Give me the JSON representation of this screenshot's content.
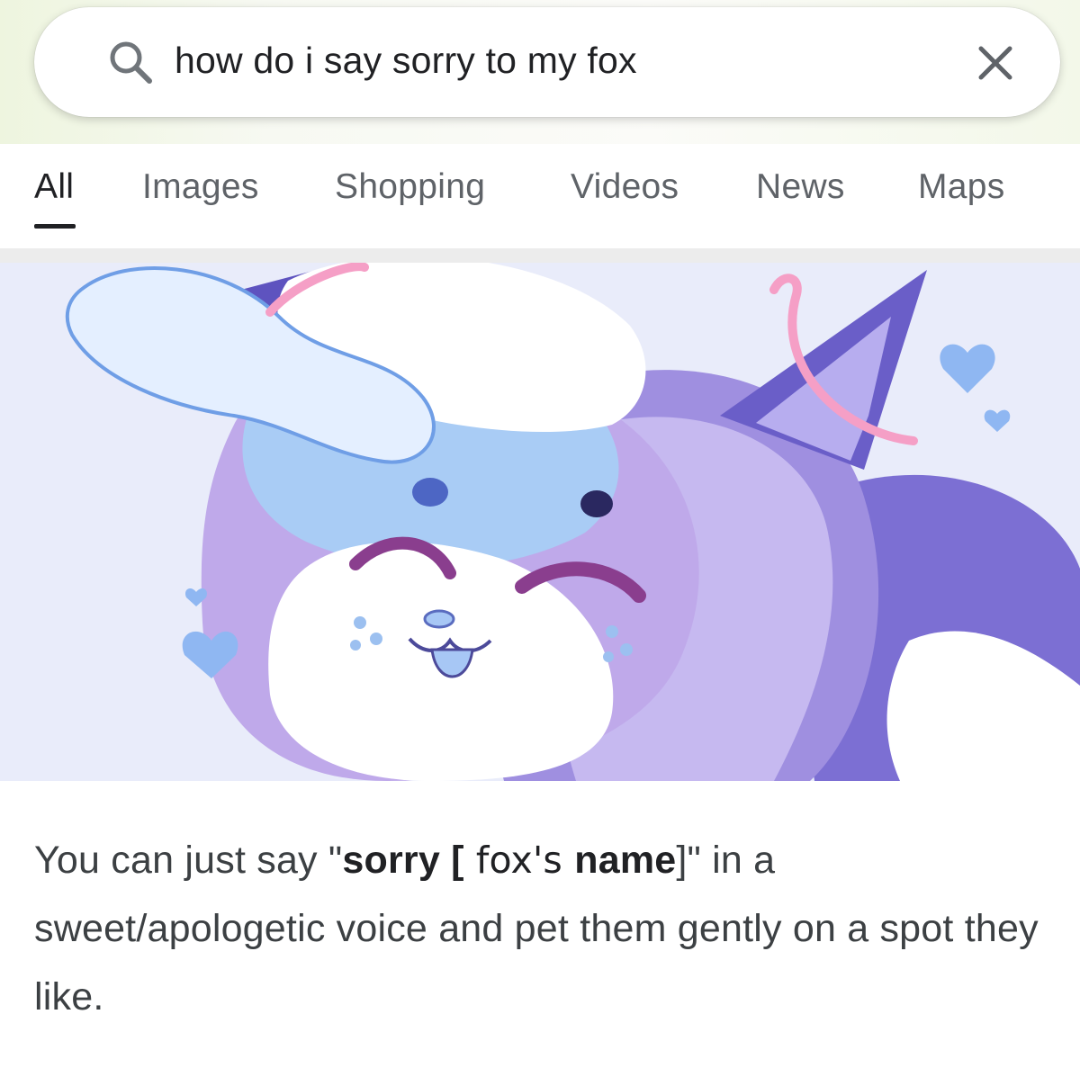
{
  "search": {
    "query": "how do i say sorry to my fox",
    "search_icon": "search-icon",
    "clear_icon": "close-icon"
  },
  "tabs": [
    {
      "label": "All",
      "active": true
    },
    {
      "label": "Images",
      "active": false
    },
    {
      "label": "Shopping",
      "active": false
    },
    {
      "label": "Videos",
      "active": false
    },
    {
      "label": "News",
      "active": false
    },
    {
      "label": "Maps",
      "active": false
    }
  ],
  "result": {
    "snippet": {
      "part1": "You can just say \"",
      "bold1": "sorry [",
      "inserted": " fox's ",
      "bold2": "name",
      "part2": "]\" in a sweet/apologetic voice and pet them gently on a spot they like."
    }
  },
  "colors": {
    "text_primary": "#202124",
    "text_secondary": "#5f6368",
    "image_background": "#e9ecfa"
  }
}
